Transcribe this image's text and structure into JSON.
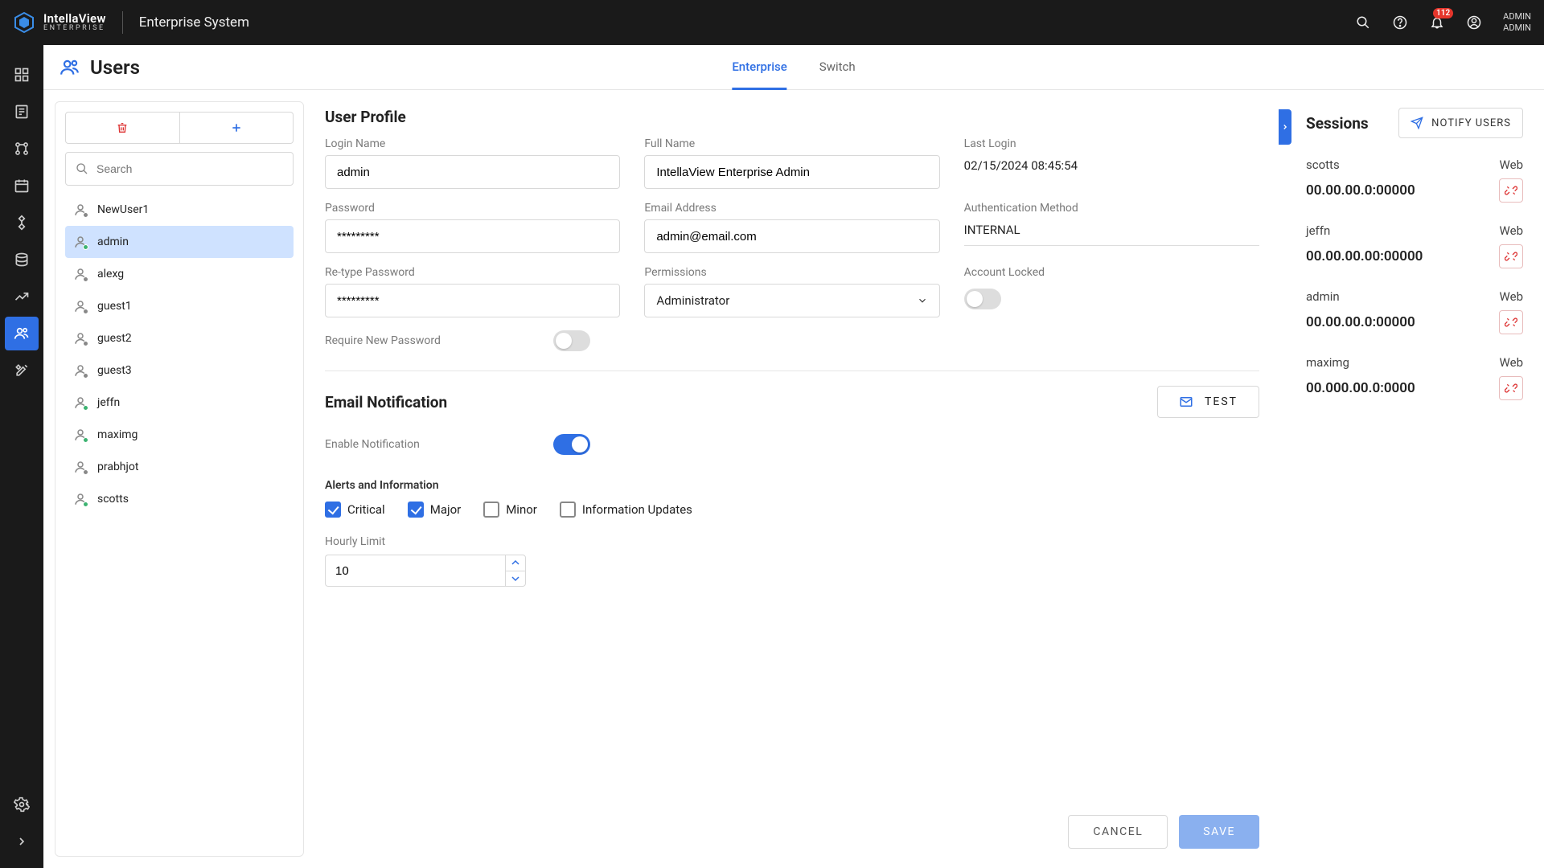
{
  "topbar": {
    "brand_line1": "IntellaView",
    "brand_line2": "ENTERPRISE",
    "title": "Enterprise System",
    "notif_count": "112",
    "user_line1": "ADMIN",
    "user_line2": "ADMIN"
  },
  "page": {
    "title": "Users",
    "tabs": [
      "Enterprise",
      "Switch"
    ],
    "active_tab": 0
  },
  "userlist": {
    "search_placeholder": "Search",
    "users": [
      {
        "name": "NewUser1",
        "dot": "#888"
      },
      {
        "name": "admin",
        "dot": "#3cb371",
        "selected": true
      },
      {
        "name": "alexg",
        "dot": "#888"
      },
      {
        "name": "guest1",
        "dot": "#888"
      },
      {
        "name": "guest2",
        "dot": "#888"
      },
      {
        "name": "guest3",
        "dot": "#888"
      },
      {
        "name": "jeffn",
        "dot": "#3cb371"
      },
      {
        "name": "maximg",
        "dot": "#3cb371"
      },
      {
        "name": "prabhjot",
        "dot": "#888"
      },
      {
        "name": "scotts",
        "dot": "#3cb371"
      }
    ]
  },
  "profile": {
    "section_title": "User Profile",
    "labels": {
      "login": "Login Name",
      "fullname": "Full Name",
      "lastlogin": "Last Login",
      "password": "Password",
      "email": "Email Address",
      "authmethod": "Authentication Method",
      "retype": "Re-type Password",
      "permissions": "Permissions",
      "locked": "Account Locked",
      "require_new": "Require New Password"
    },
    "values": {
      "login": "admin",
      "fullname": "IntellaView Enterprise Admin",
      "lastlogin": "02/15/2024 08:45:54",
      "password": "*********",
      "email": "admin@email.com",
      "authmethod": "INTERNAL",
      "retype": "*********",
      "permissions": "Administrator",
      "locked": false,
      "require_new": false
    }
  },
  "email": {
    "section_title": "Email Notification",
    "test_label": "TEST",
    "enable_label": "Enable Notification",
    "enable_on": true,
    "alerts_label": "Alerts and Information",
    "checks": [
      {
        "label": "Critical",
        "checked": true
      },
      {
        "label": "Major",
        "checked": true
      },
      {
        "label": "Minor",
        "checked": false
      },
      {
        "label": "Information Updates",
        "checked": false
      }
    ],
    "hourly_label": "Hourly Limit",
    "hourly_value": "10"
  },
  "footer": {
    "cancel": "CANCEL",
    "save": "SAVE"
  },
  "sessions": {
    "title": "Sessions",
    "notify_label": "NOTIFY USERS",
    "items": [
      {
        "user": "scotts",
        "type": "Web",
        "addr": "00.00.00.0:00000"
      },
      {
        "user": "jeffn",
        "type": "Web",
        "addr": "00.00.00.00:00000"
      },
      {
        "user": "admin",
        "type": "Web",
        "addr": "00.00.00.0:00000"
      },
      {
        "user": "maximg",
        "type": "Web",
        "addr": "00.000.00.0:0000"
      }
    ]
  }
}
